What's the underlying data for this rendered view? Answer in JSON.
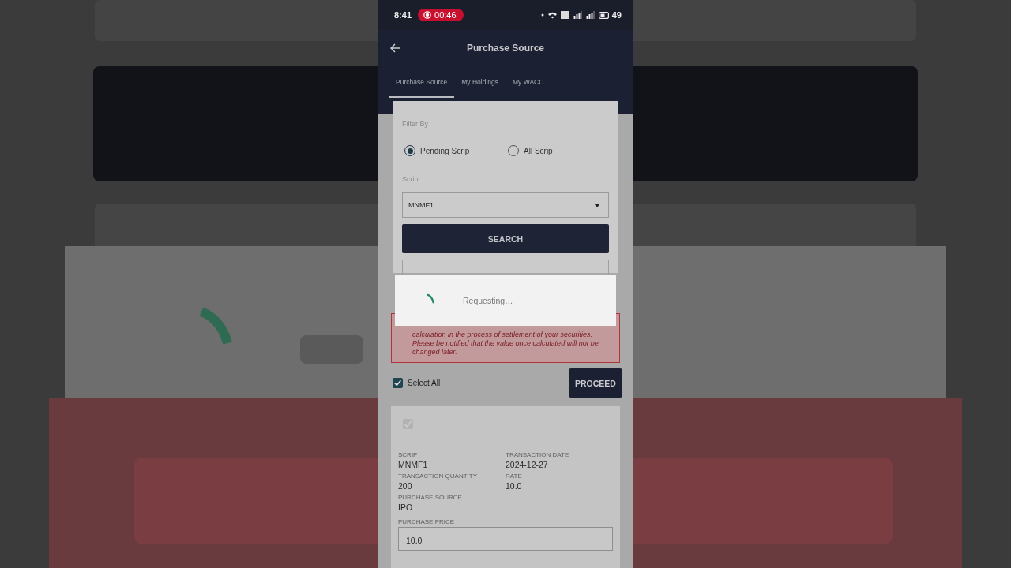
{
  "status_bar": {
    "time": "8:41",
    "recording": "00:46",
    "battery": "49"
  },
  "header": {
    "title": "Purchase Source"
  },
  "tabs": [
    {
      "label": "Purchase Source",
      "selected": true
    },
    {
      "label": "My Holdings",
      "selected": false
    },
    {
      "label": "My WACC",
      "selected": false
    }
  ],
  "filter": {
    "label": "Filter By",
    "options": [
      {
        "label": "Pending Scrip",
        "selected": true
      },
      {
        "label": "All Scrip",
        "selected": false
      }
    ]
  },
  "scrip": {
    "label": "Scrip",
    "value": "MNMF1"
  },
  "search_button": "SEARCH",
  "notice": "calculation in the process of settlement of your securities. Please be notified that the value once calculated will not be changed later.",
  "select_all": {
    "label": "Select All",
    "checked": true
  },
  "proceed_button": "PROCEED",
  "items": [
    {
      "checked": true,
      "disabled": true,
      "fields": [
        {
          "label": "SCRIP",
          "value": "MNMF1"
        },
        {
          "label": "TRANSACTION DATE",
          "value": "2024-12-27"
        },
        {
          "label": "TRANSACTION QUANTITY",
          "value": "200"
        },
        {
          "label": "RATE",
          "value": "10.0"
        },
        {
          "label": "PURCHASE SOURCE",
          "value": "IPO"
        }
      ],
      "price": {
        "label": "PURCHASE PRICE",
        "value": "10.0"
      }
    }
  ],
  "dialog": {
    "message": "Requesting…"
  }
}
